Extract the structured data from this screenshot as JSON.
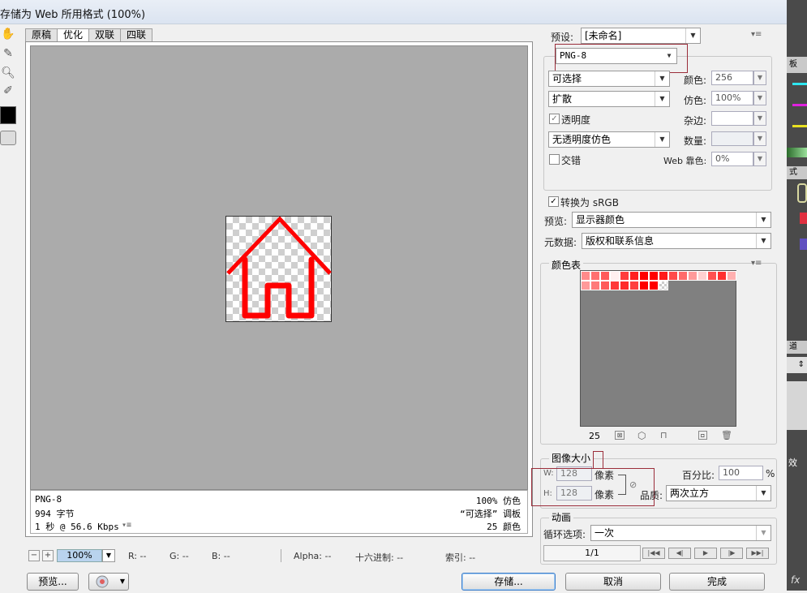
{
  "window": {
    "title": "存储为 Web 所用格式 (100%)"
  },
  "tabs": [
    "原稿",
    "优化",
    "双联",
    "四联"
  ],
  "info": {
    "format": "PNG-8",
    "size": "994 字节",
    "time": "1 秒 @ 56.6 Kbps",
    "time_menu": "▾≡",
    "dither": "100% 仿色",
    "palette": "“可选择” 调板",
    "colors": "25 颜色"
  },
  "status": {
    "zoom": "100%",
    "r": "R: --",
    "g": "G: --",
    "b": "B: --",
    "alpha": "Alpha: --",
    "hex": "十六进制: --",
    "index": "索引: --"
  },
  "buttons": {
    "preview": "预览...",
    "save": "存储...",
    "cancel": "取消",
    "done": "完成"
  },
  "settings": {
    "preset_label": "预设:",
    "preset_value": "[未命名]",
    "format": "PNG-8",
    "reduction": "可选择",
    "colors_label": "颜色:",
    "colors_value": "256",
    "dither_algo": "扩散",
    "dither_label": "仿色:",
    "dither_value": "100%",
    "transparency": "透明度",
    "matte_label": "杂边:",
    "matte_value": "",
    "trans_dither": "无透明度仿色",
    "amount_label": "数量:",
    "amount_value": "",
    "interlaced": "交错",
    "web_snap_label": "Web 靠色:",
    "web_snap_value": "0%",
    "convert_srgb": "转换为 sRGB",
    "preview_label": "预览:",
    "preview_value": "显示器颜色",
    "metadata_label": "元数据:",
    "metadata_value": "版权和联系信息"
  },
  "color_table": {
    "title": "颜色表",
    "count": "25",
    "swatches": [
      "#ff8a8a",
      "#ff7070",
      "#ff5a5a",
      "#fff0f0",
      "#ff3c3c",
      "#ff2020",
      "#ff0000",
      "#ff0000",
      "#ff1a1a",
      "#ff4a4a",
      "#ff6a6a",
      "#ff9a9a",
      "#ffd0d0",
      "#ff5050",
      "#ff3030",
      "#ffb0b0",
      "#ff9a9a",
      "#ff7a7a",
      "#ff5a5a",
      "#ff3a3a",
      "#ff2a2a",
      "#ff4040",
      "#ff0000",
      "#ff0000",
      "checker"
    ]
  },
  "image_size": {
    "title": "图像大小",
    "w_label": "W:",
    "w_value": "128",
    "h_label": "H:",
    "h_value": "128",
    "unit": "像素",
    "percent_label": "百分比:",
    "percent_value": "100",
    "percent_unit": "%",
    "quality_label": "品质:",
    "quality_value": "两次立方"
  },
  "animation": {
    "title": "动画",
    "loop_label": "循环选项:",
    "loop_value": "一次",
    "frame": "1/1"
  },
  "side_strip": {
    "panel1": "板",
    "panel2": "式",
    "panel3": "道",
    "fx": "fx",
    "eff": "效"
  },
  "colors": {
    "accent": "#ff0000",
    "canvas": "#ababab",
    "highlight_box": "#9b2d3a"
  }
}
